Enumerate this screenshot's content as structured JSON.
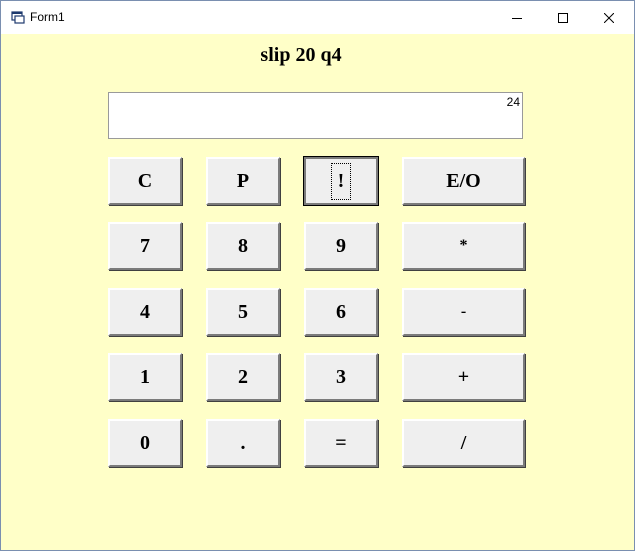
{
  "window": {
    "title": "Form1"
  },
  "heading": "slip 20 q4",
  "display": {
    "value": "24"
  },
  "keys": {
    "clear": "C",
    "p": "P",
    "factorial": "!",
    "eo": "E/O",
    "seven": "7",
    "eight": "8",
    "nine": "9",
    "multiply": "*",
    "four": "4",
    "five": "5",
    "six": "6",
    "minus": "-",
    "one": "1",
    "two": "2",
    "three": "3",
    "plus": "+",
    "zero": "0",
    "dot": ".",
    "equals": "=",
    "divide": "/"
  },
  "colors": {
    "form_background": "#ffffc8",
    "button_face": "#efefef"
  }
}
